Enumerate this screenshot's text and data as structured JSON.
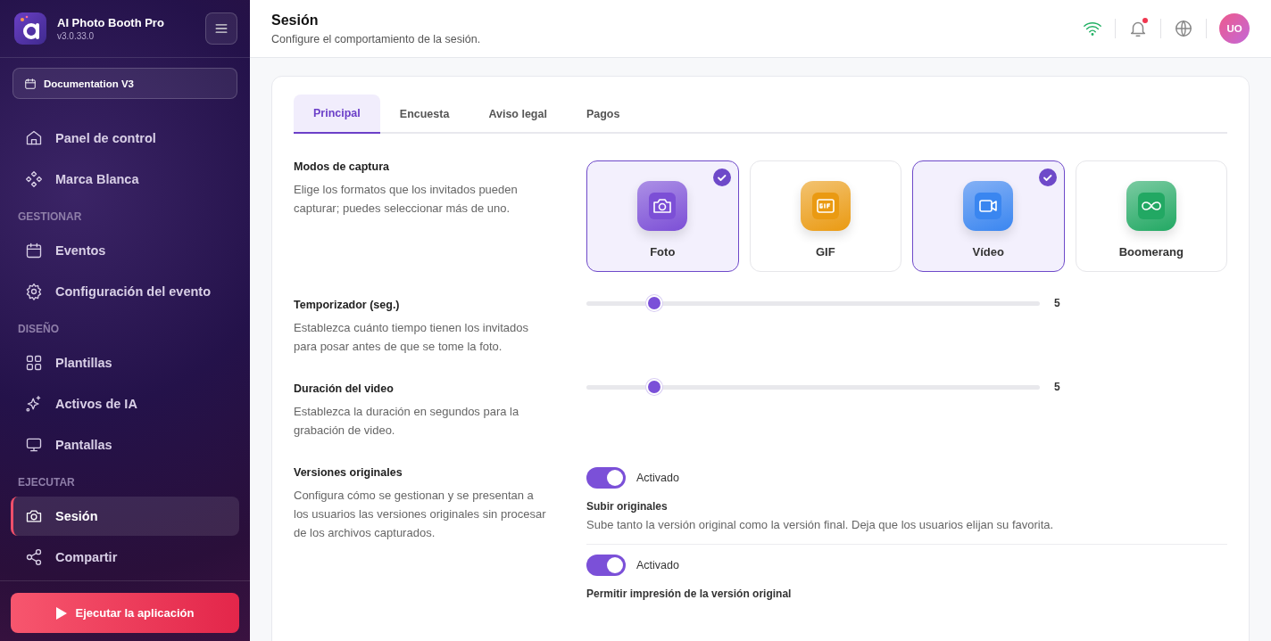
{
  "app": {
    "name": "AI Photo Booth Pro",
    "version": "v3.0.33.0"
  },
  "event_selector": {
    "label": "Documentation V3"
  },
  "sidebar": {
    "groups": [
      {
        "items": [
          {
            "label": "Panel de control",
            "kind": "home",
            "selected": false
          },
          {
            "label": "Marca Blanca",
            "kind": "diamonds",
            "selected": false
          }
        ]
      },
      {
        "heading": "GESTIONAR",
        "items": [
          {
            "label": "Eventos",
            "kind": "calendar",
            "selected": false
          },
          {
            "label": "Configuración del evento",
            "kind": "gear",
            "selected": false
          }
        ]
      },
      {
        "heading": "DISEÑO",
        "items": [
          {
            "label": "Plantillas",
            "kind": "grid",
            "selected": false
          },
          {
            "label": "Activos de IA",
            "kind": "sparkle",
            "selected": false
          },
          {
            "label": "Pantallas",
            "kind": "monitor",
            "selected": false
          }
        ]
      },
      {
        "heading": "EJECUTAR",
        "items": [
          {
            "label": "Sesión",
            "kind": "camera",
            "selected": true
          },
          {
            "label": "Compartir",
            "kind": "share",
            "selected": false
          }
        ]
      }
    ]
  },
  "run_button": {
    "label": "Ejecutar la aplicación"
  },
  "header": {
    "title": "Sesión",
    "subtitle": "Configure el comportamiento de la sesión.",
    "notification_dot": true,
    "avatar": "UO"
  },
  "tabs": [
    {
      "label": "Principal",
      "selected": true
    },
    {
      "label": "Encuesta",
      "selected": false
    },
    {
      "label": "Aviso legal",
      "selected": false
    },
    {
      "label": "Pagos",
      "selected": false
    }
  ],
  "settings": [
    {
      "kind": "modes",
      "title": "Modos de captura",
      "description": "Elige los formatos que los invitados pueden capturar; puedes seleccionar más de uno.",
      "options": [
        {
          "label": "Foto",
          "kind": "camera",
          "color": "#7c4fd6",
          "selected": true
        },
        {
          "label": "GIF",
          "kind": "gif",
          "color": "#ea9a12",
          "selected": false
        },
        {
          "label": "Vídeo",
          "kind": "video",
          "color": "#3a86f0",
          "selected": true
        },
        {
          "label": "Boomerang",
          "kind": "infinity",
          "color": "#22a863",
          "selected": false
        }
      ]
    },
    {
      "kind": "slider",
      "title": "Temporizador (seg.)",
      "description": "Establezca cuánto tiempo tienen los invitados para posar antes de que se tome la foto.",
      "level": 0.15,
      "reading": "5"
    },
    {
      "kind": "slider",
      "title": "Duración del video",
      "description": "Establezca la duración en segundos para la grabación de video.",
      "level": 0.15,
      "reading": "5"
    },
    {
      "kind": "toggles",
      "title": "Versiones originales",
      "description": "Configura cómo se gestionan y se presentan a los usuarios las versiones originales sin procesar de los archivos capturados.",
      "toggles": [
        {
          "on": true,
          "state_label": "Activado",
          "title": "Subir originales",
          "description": "Sube tanto la versión original como la versión final. Deja que los usuarios elijan su favorita."
        },
        {
          "on": true,
          "state_label": "Activado",
          "title": "Permitir impresión de la versión original"
        }
      ]
    }
  ]
}
